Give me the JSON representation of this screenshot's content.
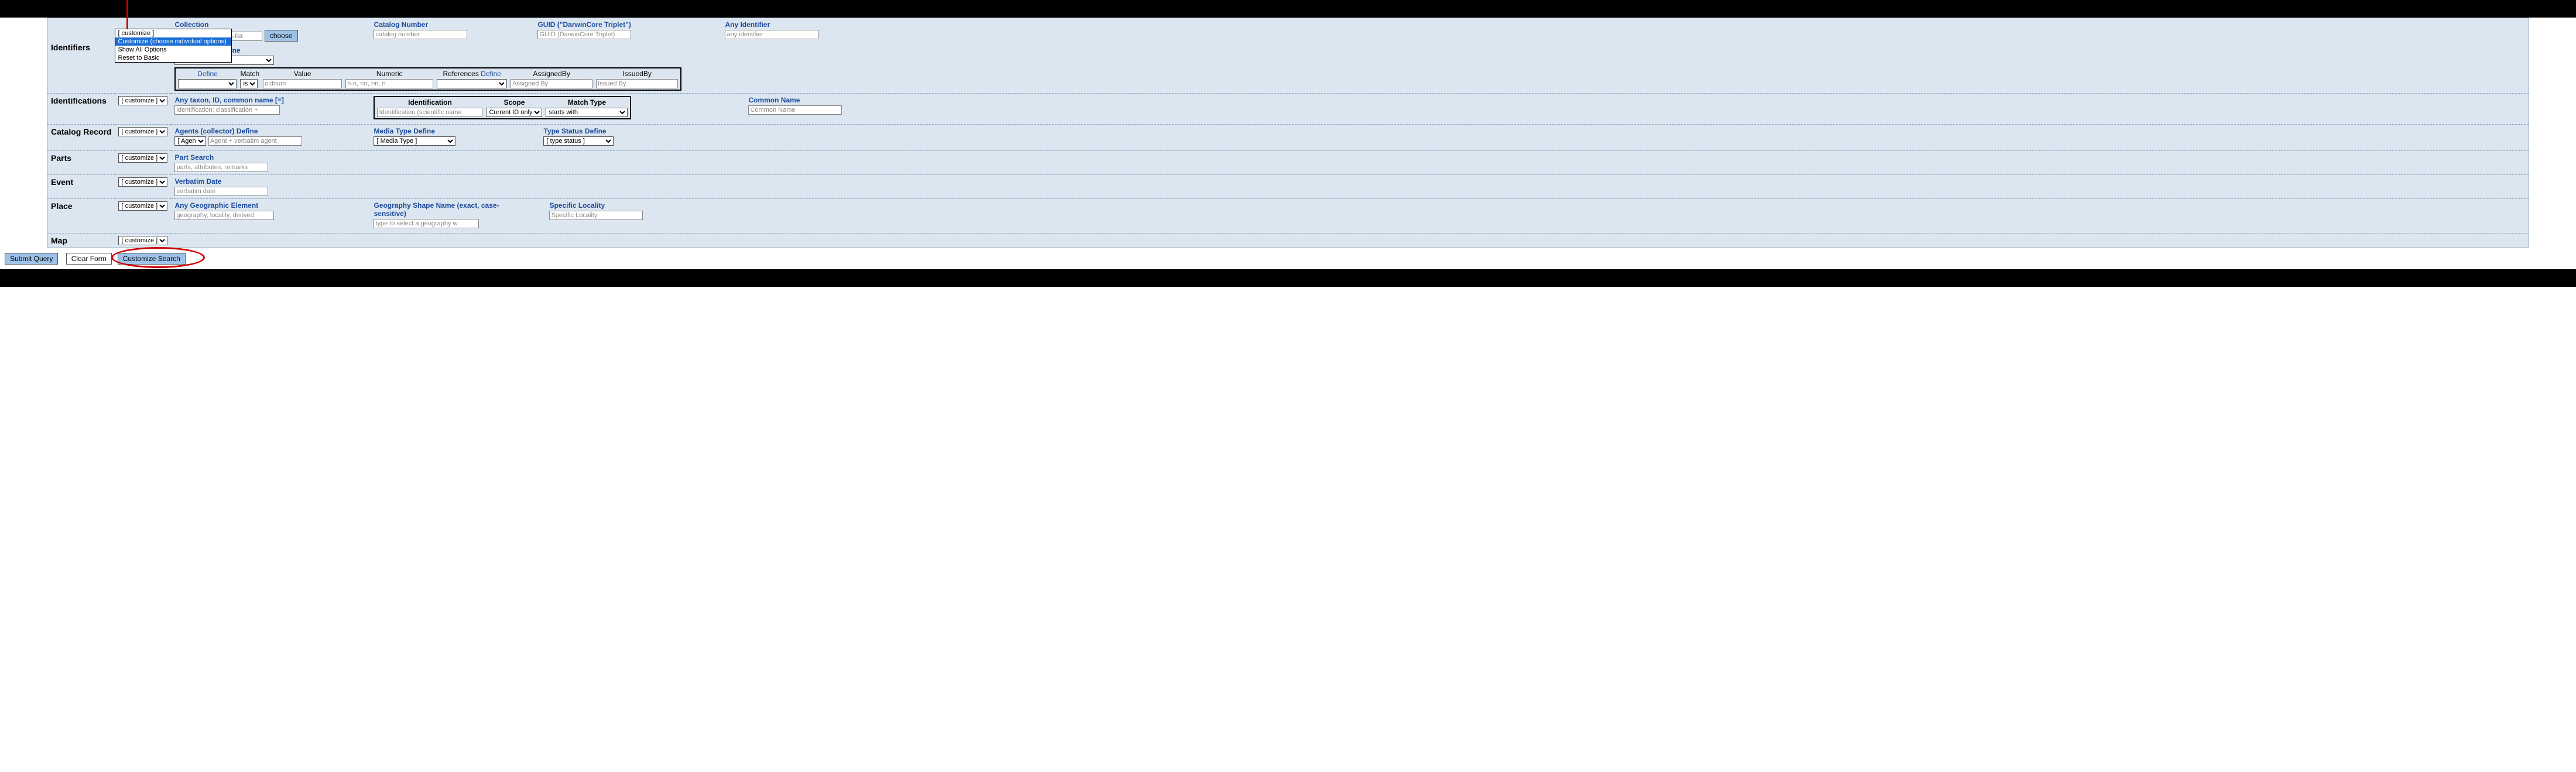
{
  "customize_label": "[ customize ]",
  "dropdown": {
    "opt0": "[ customize ]",
    "opt1": "Customize (choose individual options)",
    "opt2": "Show All Options",
    "opt3": "Reset to Basic"
  },
  "sections": {
    "identifiers": "Identifiers",
    "identifications": "Identifications",
    "catalogrecord": "Catalog Record",
    "parts": "Parts",
    "event": "Event",
    "place": "Place",
    "map": "Map"
  },
  "identifiers": {
    "collection_label": "Collection",
    "collection_placeholder": "guid_prefix, comma-list",
    "choose": "choose",
    "catalog_label": "Catalog Number",
    "catalog_placeholder": "catalog number",
    "guid_label": "GUID (\"DarwinCore Triplet\")",
    "guid_placeholder": "GUID (DarwinCore Triplet)",
    "anyid_label": "Any Identifier",
    "anyid_placeholder": "any identifier",
    "reldefine_label": "Relationship Define",
    "otherid": {
      "define": "Define",
      "match": "Match",
      "match_val": "is",
      "value": "Value",
      "value_placeholder": "oidnum",
      "numeric": "Numeric",
      "numeric_placeholder": "n-n, <n, >n, n",
      "references": "References",
      "assignedby": "AssignedBy",
      "assignedby_placeholder": "Assigned By",
      "issuedby": "IssuedBy",
      "issuedby_placeholder": "Issued By"
    }
  },
  "identifications": {
    "anytaxon_label": "Any taxon, ID, common name [=]",
    "anytaxon_placeholder": "identification; classification +",
    "id_head": "Identification",
    "scope_head": "Scope",
    "match_head": "Match Type",
    "id_placeholder": "Identification (scientific name",
    "scope_val": "Current ID only",
    "match_val": "starts with",
    "common_label": "Common Name",
    "common_placeholder": "Common Name"
  },
  "catalog": {
    "agents_label": "Agents (collector) Define",
    "agent_sel": "[ Agen",
    "agent_placeholder": "Agent + verbatim agent",
    "media_label": "Media Type Define",
    "media_sel": "[ Media Type ]",
    "type_label": "Type Status Define",
    "type_sel": "[ type status ]"
  },
  "parts": {
    "label": "Part Search",
    "placeholder": "parts, attributes, remarks"
  },
  "event": {
    "label": "Verbatim Date",
    "placeholder": "verbatim date"
  },
  "place": {
    "any_label": "Any Geographic Element",
    "any_placeholder": "geography, locality, derived",
    "shape_label": "Geography Shape Name (exact, case-sensitive)",
    "shape_placeholder": "type to select a geography w",
    "loc_label": "Specific Locality",
    "loc_placeholder": "Specific Locality"
  },
  "buttons": {
    "submit": "Submit Query",
    "clear": "Clear Form",
    "customize": "Customize Search"
  }
}
